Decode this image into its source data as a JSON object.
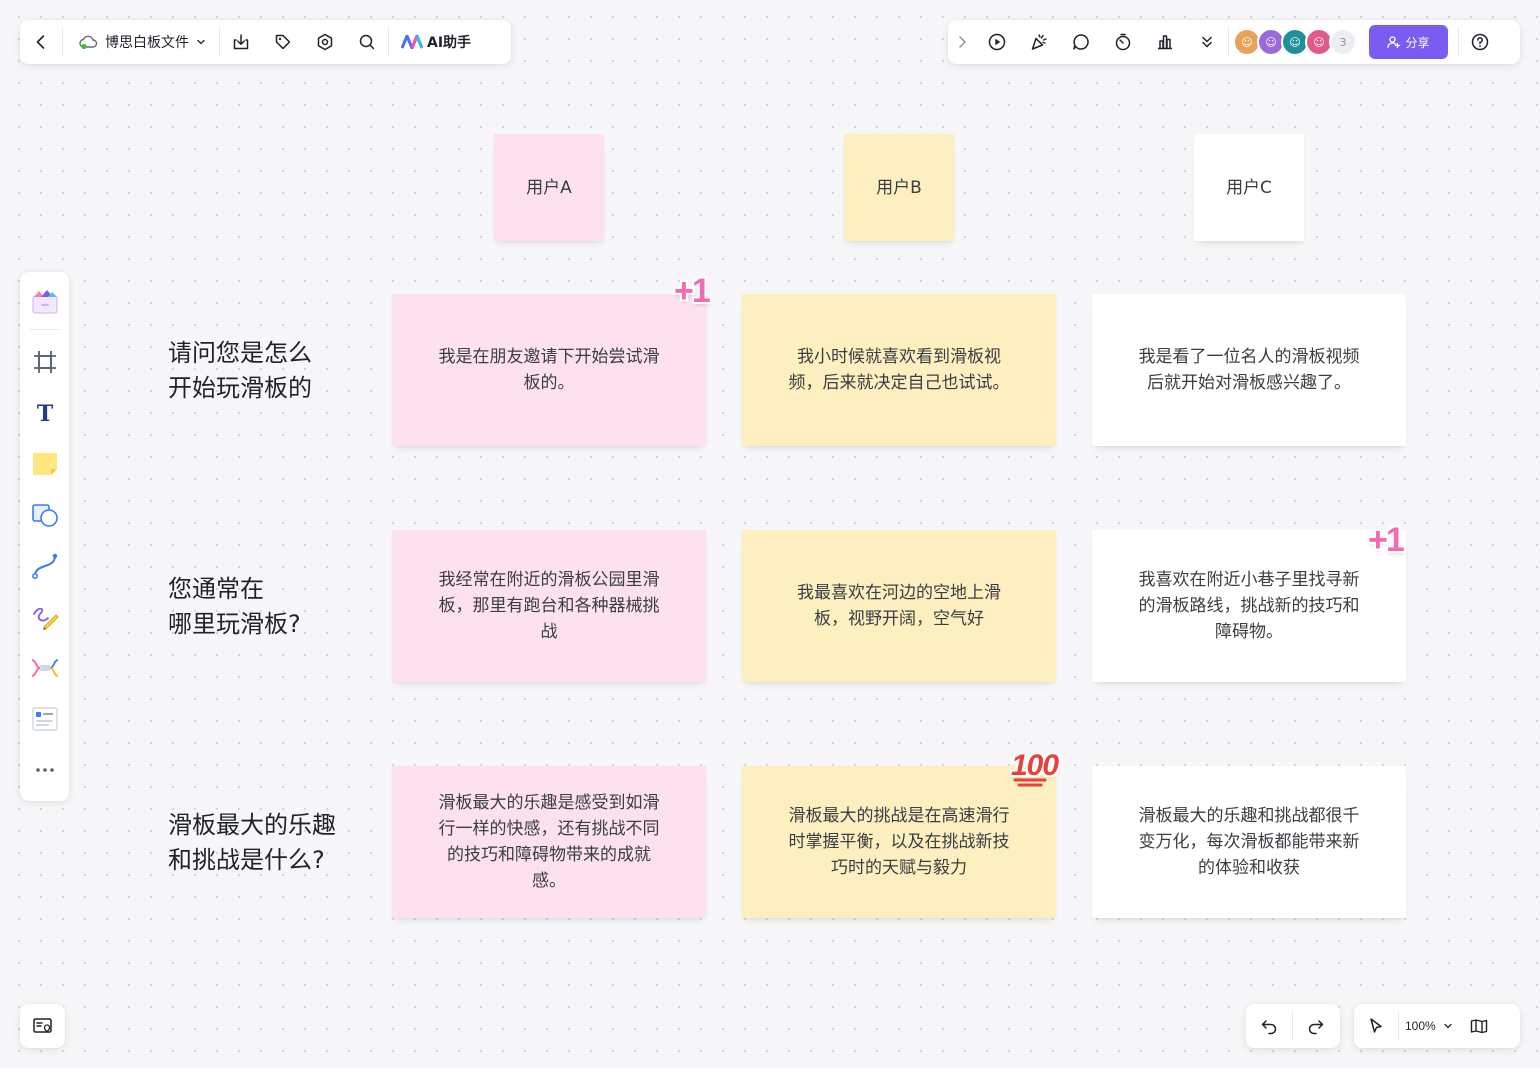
{
  "toolbar": {
    "back_icon": "chevron-left-icon",
    "file_name": "博思白板文件",
    "ai_label": "AI助手",
    "share_label": "分享",
    "collaborator_count": "3",
    "zoom": "100%"
  },
  "colors": {
    "accent": "#7b5cf0",
    "sticky_pink": "#fde1ee",
    "sticky_yellow": "#fdefbf",
    "sticky_white": "#ffffff",
    "sticker_pink": "#f06bb0",
    "sticker_red": "#e8403a"
  },
  "board": {
    "users": [
      "用户A",
      "用户B",
      "用户C"
    ],
    "questions": [
      "请问您是怎么\n开始玩滑板的",
      "您通常在\n哪里玩滑板?",
      "滑板最大的乐趣\n和挑战是什么?"
    ],
    "answers": [
      [
        "我是在朋友邀请下开始尝试滑板的。",
        "我小时候就喜欢看到滑板视频，后来就决定自己也试试。",
        "我是看了一位名人的滑板视频后就开始对滑板感兴趣了。"
      ],
      [
        "我经常在附近的滑板公园里滑板，那里有跑台和各种器械挑战",
        "我最喜欢在河边的空地上滑板，视野开阔，空气好",
        "我喜欢在附近小巷子里找寻新的滑板路线，挑战新的技巧和障碍物。"
      ],
      [
        "滑板最大的乐趣是感受到如滑行一样的快感，还有挑战不同的技巧和障碍物带来的成就感。",
        "滑板最大的挑战是在高速滑行时掌握平衡，以及在挑战新技巧时的天赋与毅力",
        "滑板最大的乐趣和挑战都很千变万化，每次滑板都能带来新的体验和收获"
      ]
    ],
    "stickers": {
      "plus_one": "+1",
      "hundred": "100"
    }
  }
}
